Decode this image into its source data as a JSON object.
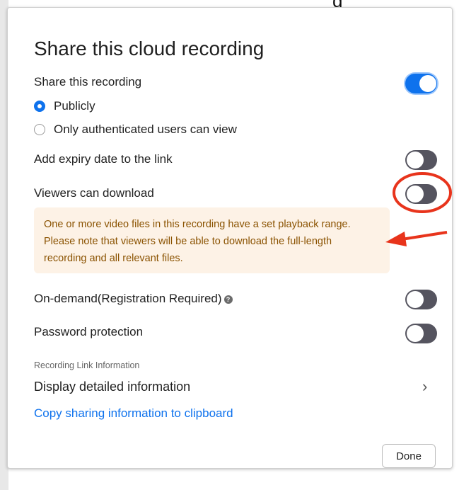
{
  "background": {
    "partial_text": "g"
  },
  "dialog": {
    "title": "Share this cloud recording",
    "share_label": "Share this recording",
    "share_on": true,
    "radio_options": [
      {
        "label": "Publicly",
        "checked": true
      },
      {
        "label": "Only authenticated users can view",
        "checked": false
      }
    ],
    "expiry_label": "Add expiry date to the link",
    "expiry_on": false,
    "download_label": "Viewers can download",
    "download_on": false,
    "warning_lines": [
      "One or more video files in this recording have a set playback range.",
      "Please note that viewers will be able to download the full-length",
      "recording and all relevant files."
    ],
    "ondemand_label": "On-demand(Registration Required)",
    "ondemand_on": false,
    "password_label": "Password protection",
    "password_on": false,
    "section_label": "Recording Link Information",
    "details_label": "Display detailed information",
    "copy_link": "Copy sharing information to clipboard",
    "done_label": "Done"
  },
  "colors": {
    "accent": "#0e72ed",
    "toggle_off": "#55545f",
    "warning_bg": "#fdf2e6",
    "warning_text": "#8a5200",
    "annotation": "#e8341c"
  }
}
